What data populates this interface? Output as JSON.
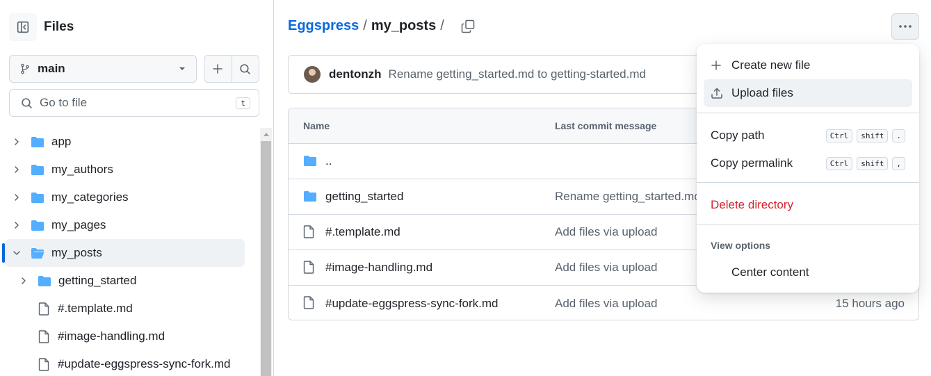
{
  "sidebar": {
    "title": "Files",
    "branch": "main",
    "goto_placeholder": "Go to file",
    "goto_shortcut": "t",
    "tree": [
      {
        "label": "app",
        "type": "folder",
        "level": 0,
        "expanded": false
      },
      {
        "label": "my_authors",
        "type": "folder",
        "level": 0,
        "expanded": false
      },
      {
        "label": "my_categories",
        "type": "folder",
        "level": 0,
        "expanded": false
      },
      {
        "label": "my_pages",
        "type": "folder",
        "level": 0,
        "expanded": false
      },
      {
        "label": "my_posts",
        "type": "folder",
        "level": 0,
        "expanded": true,
        "active": true
      },
      {
        "label": "getting_started",
        "type": "folder",
        "level": 1,
        "expanded": false
      },
      {
        "label": "#.template.md",
        "type": "file",
        "level": 1
      },
      {
        "label": "#image-handling.md",
        "type": "file",
        "level": 1
      },
      {
        "label": "#update-eggspress-sync-fork.md",
        "type": "file",
        "level": 1
      }
    ]
  },
  "breadcrumb": {
    "repo": "Eggspress",
    "sep": "/",
    "current": "my_posts",
    "trailing": "/"
  },
  "commit": {
    "author": "dentonzh",
    "message": "Rename getting_started.md to getting-started.md"
  },
  "table": {
    "col_name": "Name",
    "col_message": "Last commit message",
    "rows": [
      {
        "name": "..",
        "type": "folder",
        "message": "",
        "age": ""
      },
      {
        "name": "getting_started",
        "type": "folder",
        "message": "Rename getting_started.md",
        "age": ""
      },
      {
        "name": "#.template.md",
        "type": "file",
        "message": "Add files via upload",
        "age": ""
      },
      {
        "name": "#image-handling.md",
        "type": "file",
        "message": "Add files via upload",
        "age": ""
      },
      {
        "name": "#update-eggspress-sync-fork.md",
        "type": "file",
        "message": "Add files via upload",
        "age": "15 hours ago"
      }
    ]
  },
  "menu": {
    "create_new_file": "Create new file",
    "upload_files": "Upload files",
    "copy_path": "Copy path",
    "copy_path_keys": [
      "Ctrl",
      "shift",
      "."
    ],
    "copy_permalink": "Copy permalink",
    "copy_permalink_keys": [
      "Ctrl",
      "shift",
      ","
    ],
    "delete_directory": "Delete directory",
    "view_options": "View options",
    "center_content": "Center content"
  },
  "colors": {
    "accent": "#0969da",
    "folder": "#54aeff",
    "danger": "#d1242f",
    "muted": "#59636e"
  }
}
